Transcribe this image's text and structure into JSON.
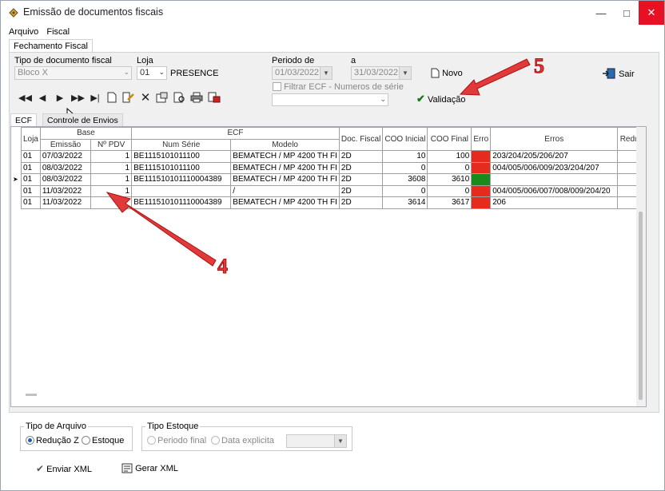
{
  "window": {
    "title": "Emissão de documentos fiscais"
  },
  "menu": [
    "Arquivo",
    "Fiscal"
  ],
  "form_tab": "Fechamento Fiscal",
  "filters": {
    "tipo_label": "Tipo de documento fiscal",
    "tipo_value": "Bloco X",
    "loja_label": "Loja",
    "loja_value": "01",
    "loja_name": "PRESENCE",
    "periodo_label": "Periodo  de",
    "periodo_de": "01/03/2022",
    "a_label": "a",
    "periodo_a": "31/03/2022",
    "filtrar_label": "Filtrar ECF - Numeros de  série"
  },
  "actions": {
    "novo": "Novo",
    "sair": "Sair",
    "validacao": "Validação"
  },
  "toolbar_icons": [
    "first-record-icon",
    "prev-record-icon",
    "next-record-icon",
    "next-page-icon",
    "last-record-icon",
    "new-document-icon",
    "edit-icon",
    "delete-icon",
    "properties-icon",
    "preview-icon",
    "print-icon",
    "export-icon"
  ],
  "inner_tabs": [
    "ECF",
    "Controle de Envios"
  ],
  "grid": {
    "group_base": "Base",
    "group_ecf": "ECF",
    "headers": [
      "Loja",
      "Emissão",
      "Nº PDV",
      "Num Série",
      "Modelo",
      "Doc. Fiscal",
      "COO Inicial",
      "COO Final",
      "Erro",
      "Erros",
      "Reduç"
    ],
    "rows": [
      {
        "loja": "01",
        "emissao": "07/03/2022",
        "pdv": "1",
        "serie": "BE1115101011100",
        "modelo": "BEMATECH / MP 4200 TH FI",
        "doc": "2D",
        "coo_ini": "10",
        "coo_fim": "100",
        "erro": "red",
        "erros": "203/204/205/206/207",
        "current": false
      },
      {
        "loja": "01",
        "emissao": "08/03/2022",
        "pdv": "1",
        "serie": "BE1115101011100",
        "modelo": "BEMATECH / MP 4200 TH FI",
        "doc": "2D",
        "coo_ini": "0",
        "coo_fim": "0",
        "erro": "red",
        "erros": "004/005/006/009/203/204/207",
        "current": false
      },
      {
        "loja": "01",
        "emissao": "08/03/2022",
        "pdv": "1",
        "serie": "BE111510101110004389",
        "modelo": "BEMATECH / MP 4200 TH FI",
        "doc": "2D",
        "coo_ini": "3608",
        "coo_fim": "3610",
        "erro": "green",
        "erros": "",
        "current": true
      },
      {
        "loja": "01",
        "emissao": "11/03/2022",
        "pdv": "1",
        "serie": "",
        "modelo": "/",
        "doc": "2D",
        "coo_ini": "0",
        "coo_fim": "0",
        "erro": "red",
        "erros": "004/005/006/007/008/009/204/20",
        "current": false
      },
      {
        "loja": "01",
        "emissao": "11/03/2022",
        "pdv": "",
        "serie": "BE111510101110004389",
        "modelo": "BEMATECH / MP 4200 TH FI",
        "doc": "2D",
        "coo_ini": "3614",
        "coo_fim": "3617",
        "erro": "red",
        "erros": "206",
        "current": false
      }
    ]
  },
  "tipo_arquivo": {
    "legend": "Tipo de Arquivo",
    "opt1": "Redução Z",
    "opt2": "Estoque",
    "selected": "opt1"
  },
  "tipo_estoque": {
    "legend": "Tipo Estoque",
    "opt1": "Periodo final",
    "opt2": "Data explicita"
  },
  "bottom_actions": {
    "enviar": "Enviar XML",
    "gerar": "Gerar XML"
  },
  "annotations": {
    "callout_4": "4",
    "callout_5": "5"
  },
  "colors": {
    "error_red": "#e52b1e",
    "ok_green": "#1a8a1a",
    "callout": "#e23a3a"
  }
}
